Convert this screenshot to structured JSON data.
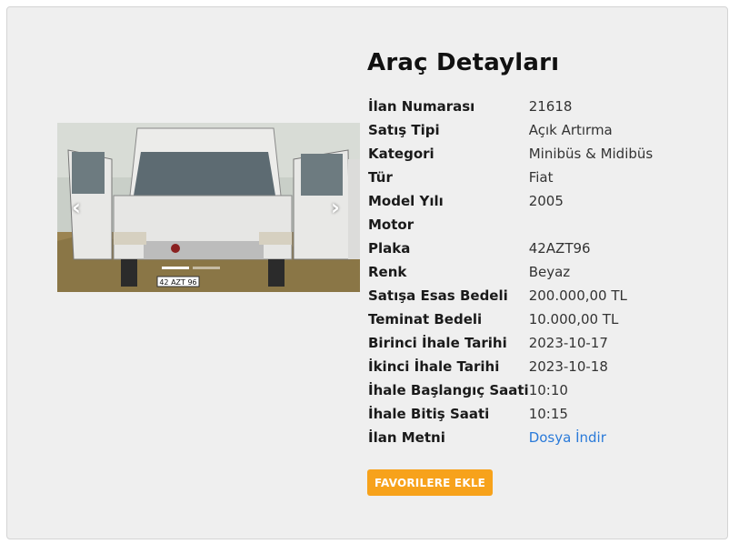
{
  "page": {
    "title": "Araç Detayları"
  },
  "carousel": {
    "prev_label": "‹",
    "next_label": "›",
    "slide_count": 2,
    "active_index": 0,
    "plate_text": "42 AZT 96"
  },
  "details": {
    "ilan_numarasi": {
      "label": "İlan Numarası",
      "value": "21618"
    },
    "satis_tipi": {
      "label": "Satış Tipi",
      "value": "Açık Artırma"
    },
    "kategori": {
      "label": "Kategori",
      "value": "Minibüs & Midibüs"
    },
    "tur": {
      "label": "Tür",
      "value": "Fiat"
    },
    "model_yili": {
      "label": "Model Yılı",
      "value": "2005"
    },
    "motor": {
      "label": "Motor",
      "value": ""
    },
    "plaka": {
      "label": "Plaka",
      "value": "42AZT96"
    },
    "renk": {
      "label": "Renk",
      "value": "Beyaz"
    },
    "satisa_esas_bedeli": {
      "label": "Satışa Esas Bedeli",
      "value": "200.000,00 TL"
    },
    "teminat_bedeli": {
      "label": "Teminat Bedeli",
      "value": "10.000,00 TL"
    },
    "birinci_ihale_tarihi": {
      "label": "Birinci İhale Tarihi",
      "value": "2023-10-17"
    },
    "ikinci_ihale_tarihi": {
      "label": "İkinci İhale Tarihi",
      "value": "2023-10-18"
    },
    "ihale_baslangic_saati": {
      "label": "İhale Başlangıç Saati",
      "value": "10:10"
    },
    "ihale_bitis_saati": {
      "label": "İhale Bitiş Saati",
      "value": "10:15"
    },
    "ilan_metni": {
      "label": "İlan Metni",
      "link_text": "Dosya İndir"
    }
  },
  "actions": {
    "favorite_label": "FAVORILERE EKLE"
  },
  "colors": {
    "accent": "#f7a21b",
    "link": "#2a7ad9",
    "card_bg": "#efefef"
  }
}
